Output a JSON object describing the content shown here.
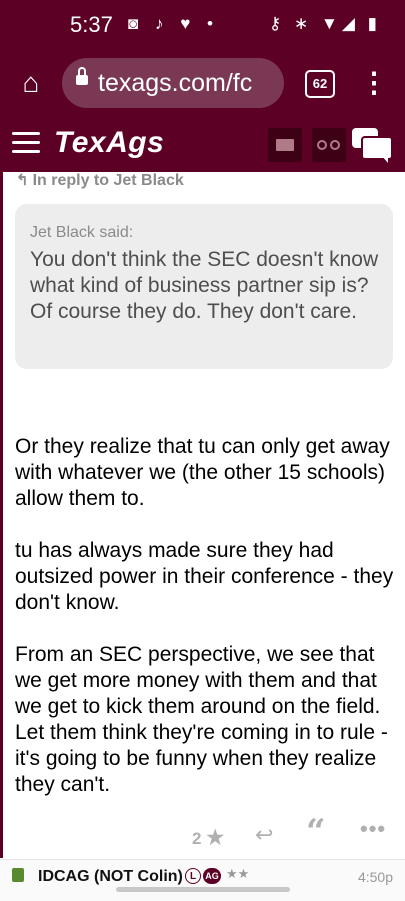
{
  "status_bar": {
    "time": "5:37",
    "left_icons": "◙ ♪ ♥ •",
    "right_icons": "⚷ ∗ ▼◢ ▮"
  },
  "browser": {
    "url_text": "texags.com/fc",
    "tab_count": "62",
    "home_icon": "⌂",
    "menu_icon": "⋮"
  },
  "site_header": {
    "logo": "TexAgs"
  },
  "post": {
    "reply_to": "In reply to Jet Black",
    "quote_author": "Jet Black said:",
    "quote_text": "You don't think the SEC doesn't know what kind of business partner sip is? Of course they do. They don't care.",
    "paragraphs": [
      "Or they realize that tu can only get away with whatever we (the other 15 schools) allow them to.",
      "tu has always made sure they had outsized power in their conference - they don't know.",
      "From an SEC perspective, we see that we get more money with them and that we get to kick them around on the field. Let them think they're coming in to rule - it's going to be funny when they realize they can't."
    ],
    "star_count": "2",
    "star_icon": "★",
    "reply_icon": "↩",
    "quote_icon": "“",
    "more_icon": "•••"
  },
  "next_post": {
    "username": "IDCAG (NOT Colin)",
    "badge_l": "L",
    "badge_ag": "AG",
    "rank_stars": "★★",
    "timestamp": "4:50p"
  },
  "colors": {
    "maroon": "#5c0025",
    "quote_bg": "#ededed",
    "muted": "#8a8a8a"
  }
}
